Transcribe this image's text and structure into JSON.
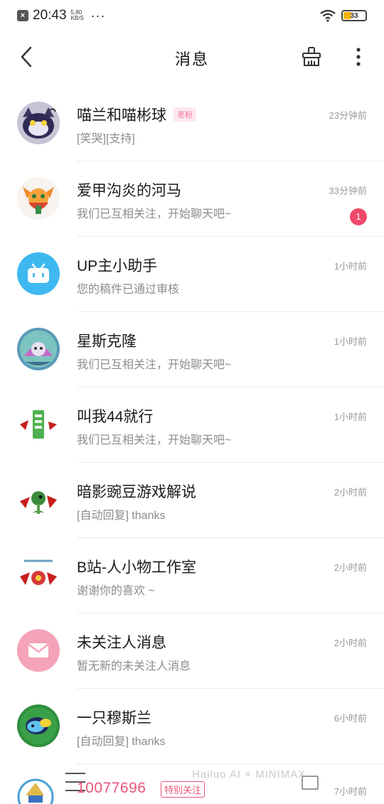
{
  "status_bar": {
    "time": "20:43",
    "speed": "5.80 KB/S",
    "more": "···",
    "battery": "33",
    "battery_level": 0.33
  },
  "nav": {
    "title": "消息",
    "back_icon": "chevron-left-icon",
    "clean_icon": "broom-icon",
    "more_icon": "vertical-dots-icon"
  },
  "messages": [
    {
      "name": "喵兰和喵彬球",
      "tag": "老粉",
      "preview": "[笑哭][支持]",
      "time": "23分钟前",
      "unread": ""
    },
    {
      "name": "爱甲沟炎的河马",
      "tag": "",
      "preview": "我们已互相关注，开始聊天吧~",
      "time": "33分钟前",
      "unread": "1"
    },
    {
      "name": "UP主小助手",
      "tag": "",
      "preview": "您的稿件已通过审核",
      "time": "1小时前",
      "unread": ""
    },
    {
      "name": "星斯克隆",
      "tag": "",
      "preview": "我们已互相关注，开始聊天吧~",
      "time": "1小时前",
      "unread": ""
    },
    {
      "name": "叫我44就行",
      "tag": "",
      "preview": "我们已互相关注，开始聊天吧~",
      "time": "1小时前",
      "unread": ""
    },
    {
      "name": "暗影豌豆游戏解说",
      "tag": "",
      "preview": "[自动回复] thanks",
      "time": "2小时前",
      "unread": ""
    },
    {
      "name": "B站-人小物工作室",
      "tag": "",
      "preview": "谢谢你的喜欢 ~",
      "time": "2小时前",
      "unread": ""
    },
    {
      "name": "未关注人消息",
      "tag": "",
      "preview": "暂无新的未关注人消息",
      "time": "2小时前",
      "unread": ""
    },
    {
      "name": "一只穆斯兰",
      "tag": "",
      "preview": "[自动回复] thanks",
      "time": "6小时前",
      "unread": ""
    }
  ],
  "bottom": {
    "uid": "10077696",
    "follow_label": "特别关注",
    "watermark": "Hailuo AI × MINIMAX",
    "time": "7小时前"
  },
  "colors": {
    "accent_pink": "#e8557b",
    "badge_red": "#f04a6a",
    "assistant_blue": "#3fb8f0",
    "envelope_pink": "#f4a3b8"
  }
}
